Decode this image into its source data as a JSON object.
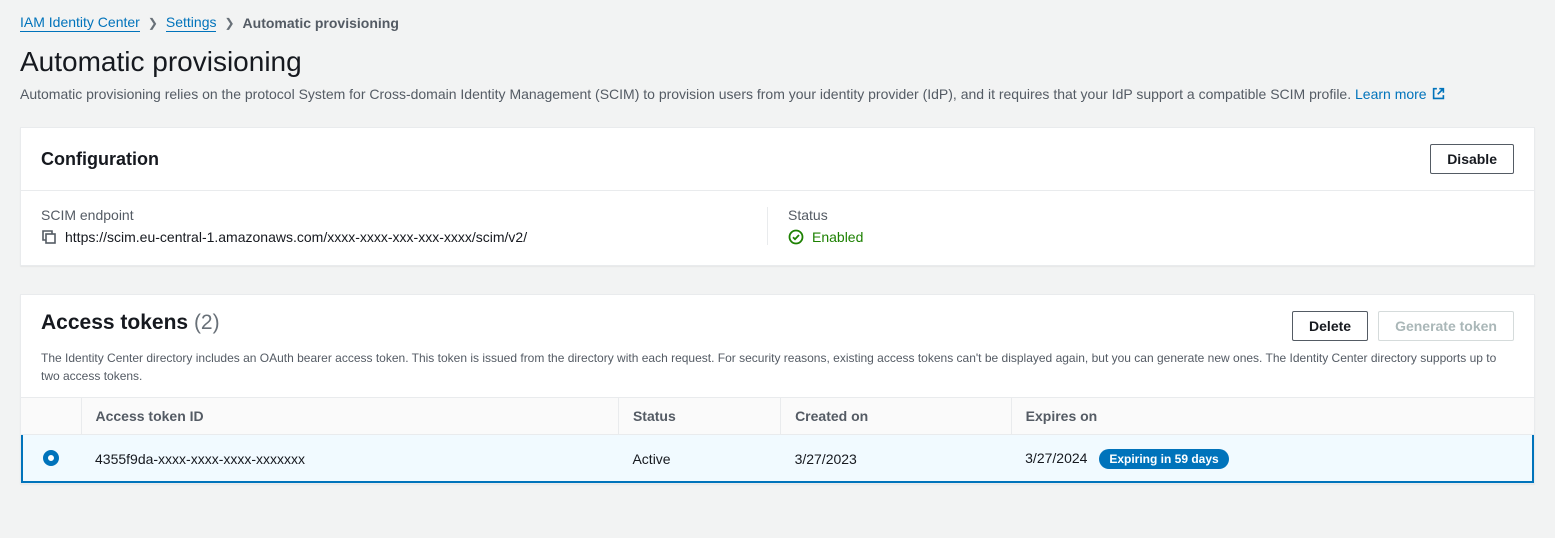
{
  "breadcrumb": {
    "root": "IAM Identity Center",
    "mid": "Settings",
    "current": "Automatic provisioning"
  },
  "page": {
    "title": "Automatic provisioning",
    "description": "Automatic provisioning relies on the protocol System for Cross-domain Identity Management (SCIM) to provision users from your identity provider (IdP), and it requires that your IdP support a compatible SCIM profile. ",
    "learn_more": "Learn more"
  },
  "config": {
    "title": "Configuration",
    "disable_label": "Disable",
    "endpoint_label": "SCIM endpoint",
    "endpoint_value": "https://scim.eu-central-1.amazonaws.com/xxxx-xxxx-xxx-xxx-xxxx/scim/v2/",
    "status_label": "Status",
    "status_value": "Enabled"
  },
  "tokens": {
    "title": "Access tokens",
    "count": "(2)",
    "delete_label": "Delete",
    "generate_label": "Generate token",
    "description": "The Identity Center directory includes an OAuth bearer access token. This token is issued from the directory with each request. For security reasons, existing access tokens can't be displayed again, but you can generate new ones. The Identity Center directory supports up to two access tokens.",
    "columns": {
      "id": "Access token ID",
      "status": "Status",
      "created": "Created on",
      "expires": "Expires on"
    },
    "rows": [
      {
        "id": "4355f9da-xxxx-xxxx-xxxx-xxxxxxx",
        "status": "Active",
        "created": "3/27/2023",
        "expires": "3/27/2024",
        "badge": "Expiring in 59 days",
        "selected": true
      }
    ]
  }
}
